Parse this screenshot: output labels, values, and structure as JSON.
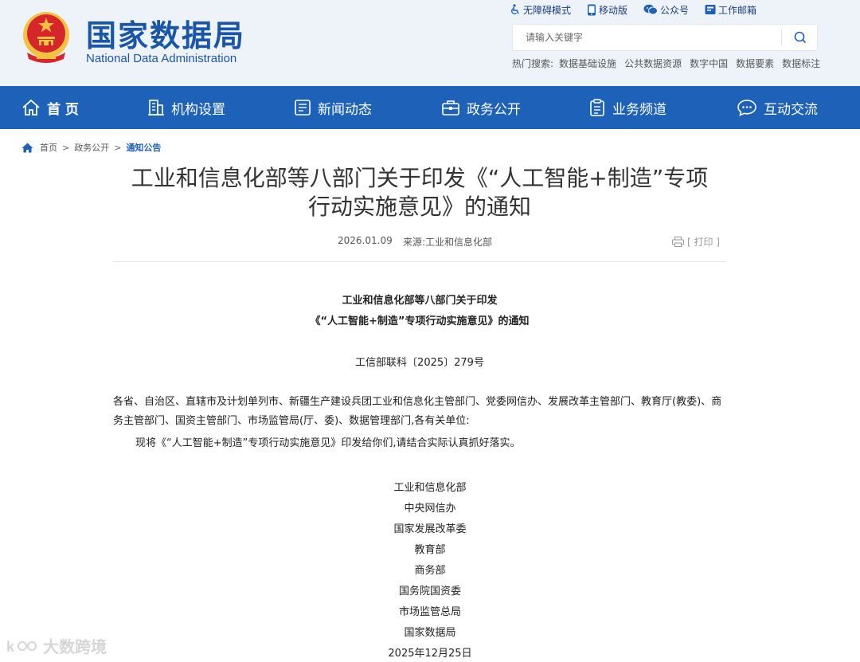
{
  "header": {
    "title": "国家数据局",
    "subtitle": "National Data Administration",
    "top_links": [
      {
        "label": "无障碍模式",
        "icon": "accessibility-icon"
      },
      {
        "label": "移动版",
        "icon": "mobile-icon"
      },
      {
        "label": "公众号",
        "icon": "wechat-icon"
      },
      {
        "label": "工作邮箱",
        "icon": "mail-icon"
      }
    ],
    "search": {
      "placeholder": "请输入关键字"
    },
    "hot_search": {
      "label": "热门搜索:",
      "items": [
        "数据基础设施",
        "公共数据资源",
        "数字中国",
        "数据要素",
        "数据标注"
      ]
    }
  },
  "nav": {
    "items": [
      {
        "label": "首 页",
        "icon": "home-icon"
      },
      {
        "label": "机构设置",
        "icon": "building-icon"
      },
      {
        "label": "新闻动态",
        "icon": "news-icon"
      },
      {
        "label": "政务公开",
        "icon": "briefcase-icon"
      },
      {
        "label": "业务频道",
        "icon": "clipboard-icon"
      },
      {
        "label": "互动交流",
        "icon": "chat-icon"
      }
    ]
  },
  "breadcrumb": {
    "items": [
      "首页",
      "政务公开",
      "通知公告"
    ],
    "separator": ">"
  },
  "article": {
    "title_line1": "工业和信息化部等八部门关于印发《“人工智能+制造”专项",
    "title_line2": "行动实施意见》的通知",
    "date": "2026.01.09",
    "source": "来源:工业和信息化部",
    "print_label": "[ 打印 ]",
    "doc_title_line1": "工业和信息化部等八部门关于印发",
    "doc_title_line2": "《“人工智能+制造”专项行动实施意见》的通知",
    "doc_number": "工信部联科〔2025〕279号",
    "recipients": "各省、自治区、直辖市及计划单列市、新疆生产建设兵团工业和信息化主管部门、党委网信办、发展改革主管部门、教育厅(教委)、商务主管部门、国资主管部门、市场监管局(厅、委)、数据管理部门,各有关单位:",
    "body": "现将《“人工智能+制造”专项行动实施意见》印发给你们,请结合实际认真抓好落实。",
    "signers": [
      "工业和信息化部",
      "中央网信办",
      "国家发展改革委",
      "教育部",
      "商务部",
      "国务院国资委",
      "市场监管总局",
      "国家数据局"
    ],
    "sign_date": "2025年12月25日"
  },
  "watermark": {
    "text": "大数跨境"
  },
  "colors": {
    "brand_blue": "#1d62b8",
    "header_bg": "#eef3fa",
    "emblem_red": "#d7262b",
    "emblem_gold": "#f4c241"
  }
}
